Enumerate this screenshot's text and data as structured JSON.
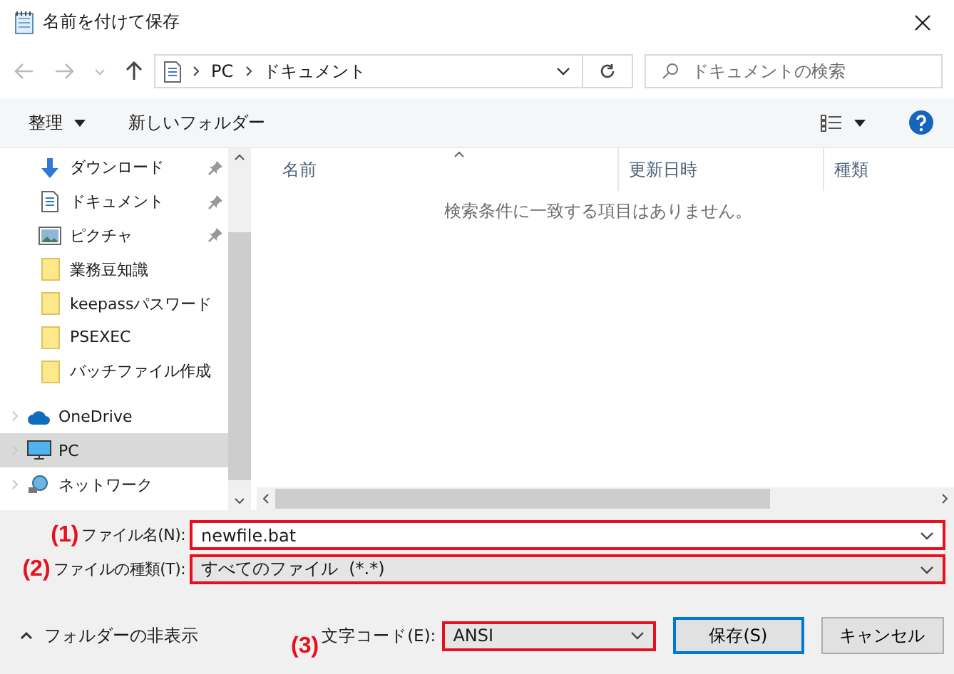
{
  "window": {
    "title": "名前を付けて保存"
  },
  "address": {
    "path": [
      "PC",
      "ドキュメント"
    ]
  },
  "search": {
    "placeholder": "ドキュメントの検索"
  },
  "toolbar": {
    "organize": "整理",
    "new_folder": "新しいフォルダー"
  },
  "sidebar": {
    "items": [
      {
        "label": "ダウンロード",
        "kind": "download",
        "pinned": true,
        "selected": false
      },
      {
        "label": "ドキュメント",
        "kind": "document",
        "pinned": true,
        "selected": false
      },
      {
        "label": "ピクチャ",
        "kind": "picture",
        "pinned": true,
        "selected": false
      },
      {
        "label": "業務豆知識",
        "kind": "folder",
        "pinned": false,
        "selected": false
      },
      {
        "label": "keepassパスワード",
        "kind": "folder",
        "pinned": false,
        "selected": false
      },
      {
        "label": "PSEXEC",
        "kind": "folder",
        "pinned": false,
        "selected": false
      },
      {
        "label": "バッチファイル作成",
        "kind": "folder",
        "pinned": false,
        "selected": false
      },
      {
        "label": "OneDrive",
        "kind": "cloud",
        "pinned": false,
        "selected": false
      },
      {
        "label": "PC",
        "kind": "computer",
        "pinned": false,
        "selected": true
      },
      {
        "label": "ネットワーク",
        "kind": "network",
        "pinned": false,
        "selected": false
      }
    ]
  },
  "file_list": {
    "columns": [
      "名前",
      "更新日時",
      "種類"
    ],
    "empty_message": "検索条件に一致する項目はありません。"
  },
  "fields": [
    {
      "marker": "(1)",
      "label": "ファイル名(N):",
      "value": "newfile.bat",
      "kind": "input"
    },
    {
      "marker": "(2)",
      "label": "ファイルの種類(T):",
      "value": "すべてのファイル  (*.*)",
      "kind": "select"
    }
  ],
  "hide_folders": "フォルダーの非表示",
  "encoding": {
    "marker": "(3)",
    "label": "文字コード(E):",
    "value": "ANSI"
  },
  "buttons": [
    {
      "label": "保存(S)",
      "default": true
    },
    {
      "label": "キャンセル",
      "default": false
    }
  ]
}
